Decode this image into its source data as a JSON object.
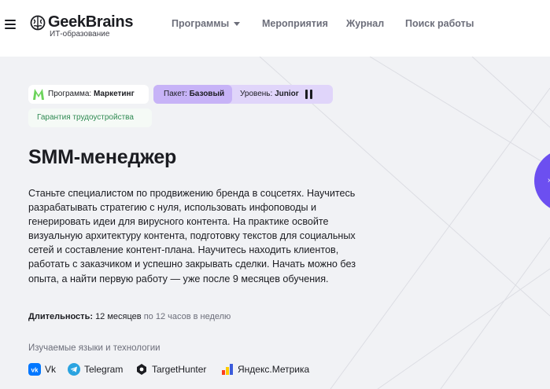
{
  "header": {
    "logo_name": "GeekBrains",
    "logo_sub": "ИТ-образование",
    "nav": {
      "programs": "Программы",
      "events": "Мероприятия",
      "journal": "Журнал",
      "jobs": "Поиск работы"
    }
  },
  "badges": {
    "program_label": "Программа:",
    "program_value": "Маркетинг",
    "package_label": "Пакет:",
    "package_value": "Базовый",
    "level_label": "Уровень:",
    "level_value": "Junior",
    "guarantee": "Гарантия трудоустройства"
  },
  "course": {
    "title": "SMM-менеджер",
    "description": "Станьте специалистом по продвижению бренда в соцсетях. Научитесь разрабатывать стратегию с нуля, использовать инфоповоды и генерировать идеи для вирусного контента. На практике освойте визуальную архитектуру контента, подготовку текстов для социальных сетей и составление контент-плана. Научитесь находить клиентов, работать с заказчиком и успешно закрывать сделки. Начать можно без опыта, а найти первую работу — уже после 9 месяцев обучения.",
    "duration_label": "Длительность:",
    "duration_value": "12 месяцев",
    "duration_extra": "по 12 часов в неделю"
  },
  "technologies": {
    "label": "Изучаемые языки и технологии",
    "items": [
      {
        "name": "Vk",
        "icon": "vk-icon",
        "color": "#0077ff"
      },
      {
        "name": "Telegram",
        "icon": "telegram-icon",
        "color": "#2aa3e0"
      },
      {
        "name": "TargetHunter",
        "icon": "targethunter-icon",
        "color": "#1b1c21"
      },
      {
        "name": "Яндекс.Метрика",
        "icon": "yandex-metrika-icon",
        "color": "#fc3f1d"
      }
    ]
  },
  "colors": {
    "accent_purple": "#6c4ff0",
    "package_badge": "#c7b3f7",
    "guarantee_text": "#2f8a52"
  }
}
